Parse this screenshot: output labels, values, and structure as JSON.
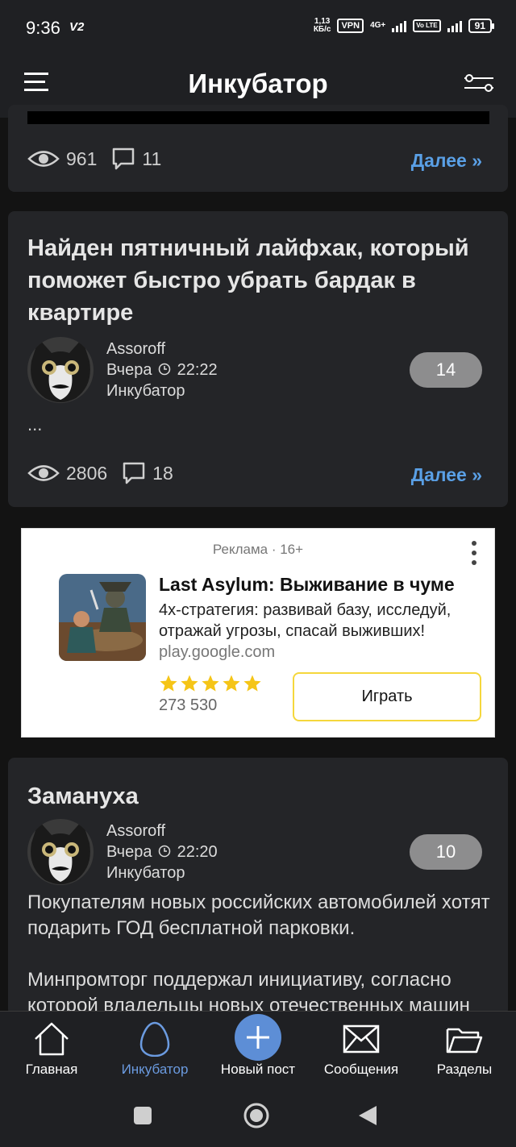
{
  "status_bar": {
    "time": "9:36",
    "network_tag": "V2",
    "speed_value": "1,13",
    "speed_unit": "КБ/с",
    "vpn": "VPN",
    "net_type": "4G+",
    "volte": "Vo LTE",
    "battery": "91"
  },
  "app_bar": {
    "title": "Инкубатор",
    "menu_icon": "hamburger-icon",
    "filter_icon": "filter-sliders-icon"
  },
  "posts": [
    {
      "views": "961",
      "comments": "11",
      "more": "Далее »"
    },
    {
      "title": "Найден пятничный лайфхак, который поможет быстро убрать бардак в квартире",
      "author": "Assoroff",
      "date": "Вчера",
      "time": "22:22",
      "section": "Инкубатор",
      "rating": "14",
      "excerpt": "...",
      "views": "2806",
      "comments": "18",
      "more": "Далее »"
    },
    {
      "title": "Замануха",
      "author": "Assoroff",
      "date": "Вчера",
      "time": "22:20",
      "section": "Инкубатор",
      "rating": "10",
      "paragraph1": "Покупателям новых российских автомобилей хотят подарить ГОД бесплатной парковки.",
      "paragraph2": "Минпромторг поддержал инициативу, согласно которой владельцы новых отечественных машин"
    }
  ],
  "ad": {
    "label": "Реклама · 16+",
    "title": "Last Asylum: Выживание в чуме",
    "description": "4х-стратегия: развивай базу, исследуй, отражай угрозы, спасай выживших!",
    "domain": "play.google.com",
    "rating_stars": 5,
    "rating_count": "273 530",
    "button": "Играть",
    "star_color": "#f5c518"
  },
  "bottom_nav": [
    {
      "label": "Главная",
      "icon": "home-icon",
      "active": false
    },
    {
      "label": "Инкубатор",
      "icon": "egg-icon",
      "active": true
    },
    {
      "label": "Новый пост",
      "icon": "plus-icon",
      "active": false
    },
    {
      "label": "Сообщения",
      "icon": "envelope-icon",
      "active": false
    },
    {
      "label": "Разделы",
      "icon": "folder-icon",
      "active": false
    }
  ],
  "colors": {
    "background": "#131313",
    "card": "#242528",
    "accent_link": "#5aa0e6",
    "active_nav": "#6b9be0",
    "fab": "#5d8ed6",
    "rating_pill": "#8d8d8e"
  }
}
